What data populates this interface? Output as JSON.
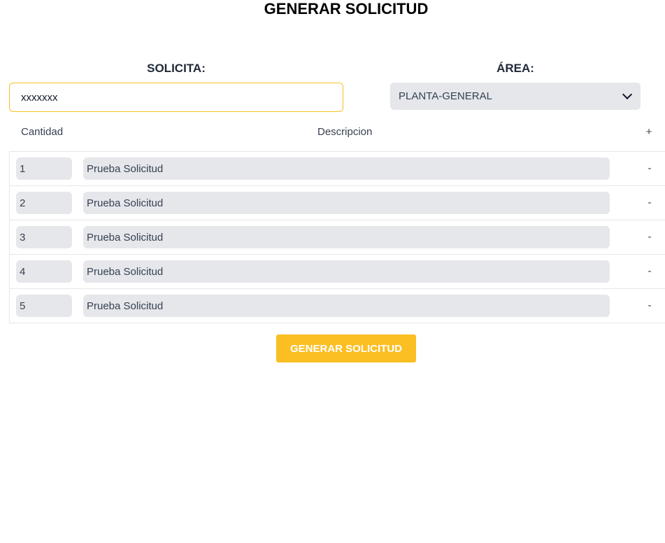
{
  "page": {
    "title": "GENERAR SOLICITUD"
  },
  "form": {
    "solicita_label": "SOLICITA:",
    "solicita_value": "xxxxxxx",
    "area_label": "ÁREA:",
    "area_selected": "PLANTA-GENERAL"
  },
  "table": {
    "headers": {
      "cantidad": "Cantidad",
      "descripcion": "Descripcion",
      "add": "+"
    },
    "remove_label": "-",
    "rows": [
      {
        "cantidad": "1",
        "descripcion": "Prueba Solicitud"
      },
      {
        "cantidad": "2",
        "descripcion": "Prueba Solicitud"
      },
      {
        "cantidad": "3",
        "descripcion": "Prueba Solicitud"
      },
      {
        "cantidad": "4",
        "descripcion": "Prueba Solicitud"
      },
      {
        "cantidad": "5",
        "descripcion": "Prueba Solicitud"
      }
    ]
  },
  "actions": {
    "submit_label": "GENERAR SOLICITUD"
  },
  "colors": {
    "accent": "#fbbf24",
    "field_bg": "#e5e7eb",
    "border": "#e5e7eb"
  }
}
